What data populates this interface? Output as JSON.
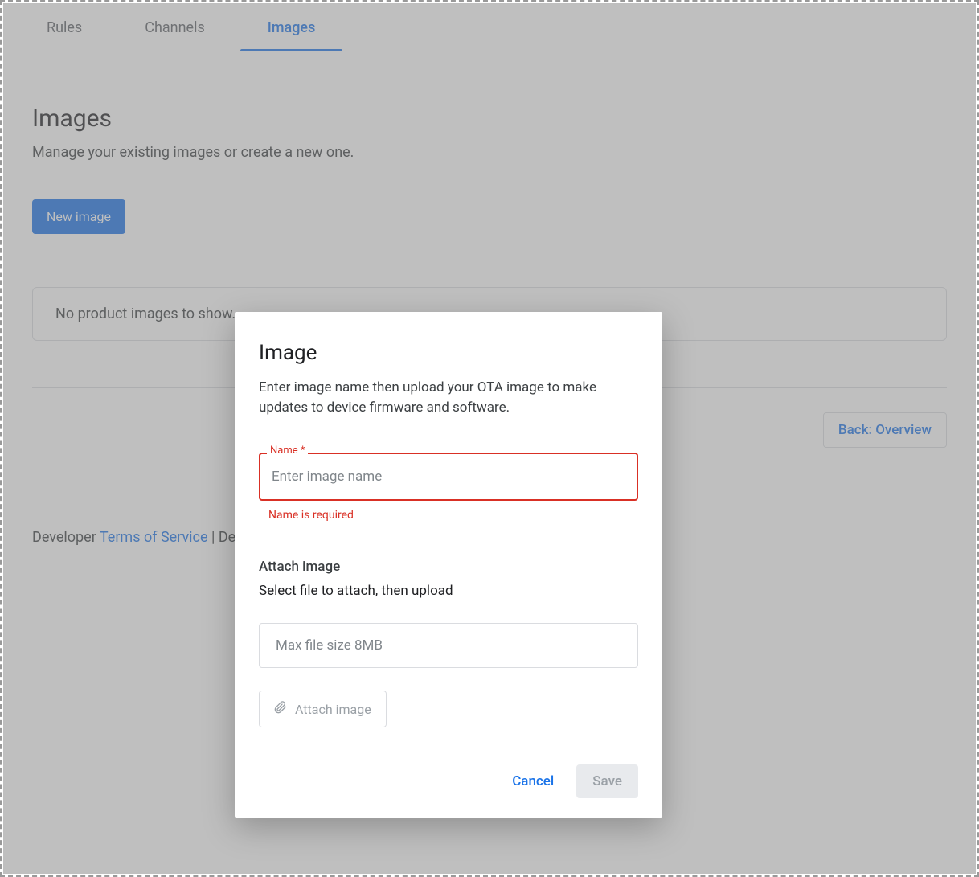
{
  "tabs": {
    "rules": "Rules",
    "channels": "Channels",
    "images": "Images"
  },
  "page": {
    "title": "Images",
    "subtitle": "Manage your existing images or create a new one.",
    "new_image_btn": "New image",
    "empty_message": "No product images to show.",
    "back_btn": "Back: Overview"
  },
  "footer": {
    "prefix": "Developer ",
    "tos": "Terms of Service",
    "sep": " | Deve"
  },
  "dialog": {
    "title": "Image",
    "description": "Enter image name then upload your OTA image to make updates to device firmware and software.",
    "name_label": "Name *",
    "name_placeholder": "Enter image name",
    "name_value": "",
    "name_error": "Name is required",
    "attach_title": "Attach image",
    "attach_desc": "Select file to attach, then upload",
    "file_placeholder": "Max file size 8MB",
    "attach_btn": "Attach image",
    "cancel": "Cancel",
    "save": "Save"
  }
}
